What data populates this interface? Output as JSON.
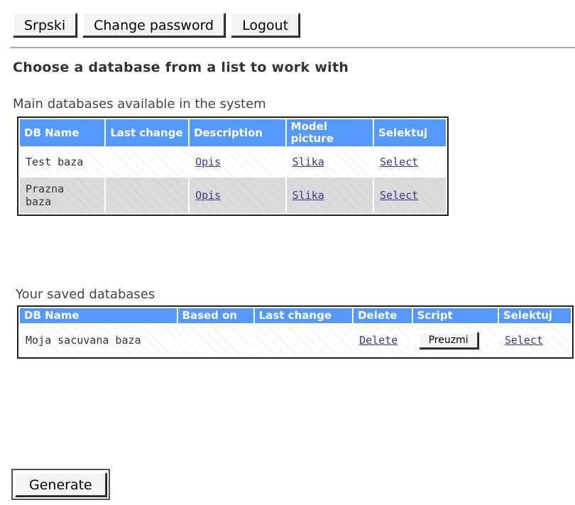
{
  "toolbar": {
    "lang_label": "Srpski",
    "change_password_label": "Change password",
    "logout_label": "Logout"
  },
  "heading": "Choose a database from a list to work with",
  "main_section": {
    "caption": "Main databases available in the system",
    "headers": [
      "DB Name",
      "Last change",
      "Description",
      "Model picture",
      "Selektuj"
    ],
    "rows": [
      {
        "name": "Test baza",
        "last_change": "",
        "description": "Opis",
        "picture": "Slika",
        "select": "Select"
      },
      {
        "name": "Prazna baza",
        "last_change": "",
        "description": "Opis",
        "picture": "Slika",
        "select": "Select"
      }
    ]
  },
  "saved_section": {
    "caption": "Your saved databases",
    "headers": [
      "DB Name",
      "Based on",
      "Last change",
      "Delete",
      "Script",
      "Selektuj"
    ],
    "rows": [
      {
        "name": "Moja sacuvana baza",
        "based_on": "",
        "last_change": "",
        "delete": "Delete",
        "script_button": "Preuzmi",
        "select": "Select"
      }
    ]
  },
  "generate_label": "Generate",
  "colors": {
    "header_bg": "#5599ff",
    "link": "#3a3a8a",
    "alt_row": "#dcdcdc"
  }
}
